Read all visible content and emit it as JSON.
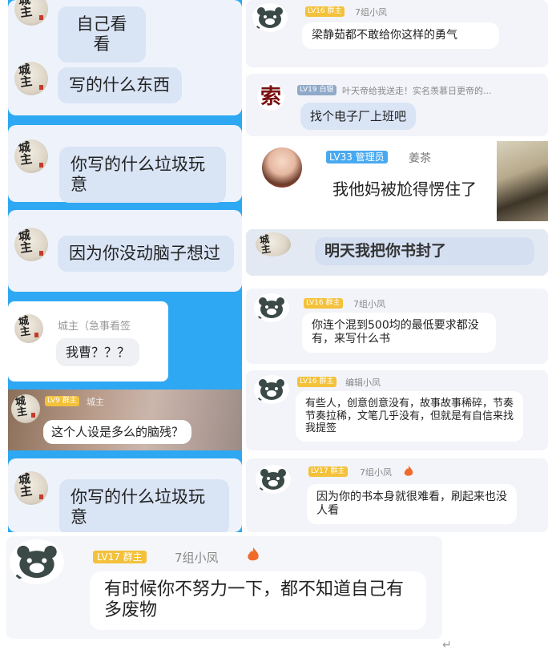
{
  "left_panel": {
    "messages": [
      {
        "text": "自己看看"
      },
      {
        "text": "写的什么东西"
      },
      {
        "text": "你写的什么垃圾玩意"
      },
      {
        "text": "因为你没动脑子想过"
      },
      {
        "nick": "城主（急事看签",
        "text": "我曹？？？"
      },
      {
        "badge": "LV9 群主",
        "nick": "城主",
        "text": "这个人设是多么的脑残？"
      },
      {
        "text": "你写的什么垃圾玩意"
      }
    ]
  },
  "right_panel": {
    "messages": [
      {
        "badge": "LV16 群主",
        "nick": "7组小凤",
        "text": "梁静茹都不敢给你这样的勇气"
      },
      {
        "badge": "LV19 白银",
        "nick": "叶天帝给我送走！实名羡慕日更帝的...",
        "text": "找个电子厂上班吧"
      },
      {
        "badge": "LV33 管理员",
        "nick": "姜茶",
        "text": "我他妈被尬得愣住了"
      },
      {
        "text": "明天我把你书封了"
      },
      {
        "badge": "LV16 群主",
        "nick": "7组小凤",
        "text": "你连个混到500均的最低要求都没有，来写什么书"
      },
      {
        "badge": "LV16 群主",
        "nick": "编辑小凤",
        "text": "有些人，创意创意没有，故事故事稀碎，节奏节奏拉稀，文笔几乎没有，但就是有自信来找我提签"
      },
      {
        "badge": "LV17 群主",
        "nick": "7组小凤",
        "text": "因为你的书本身就很难看，刷起来也没人看"
      }
    ],
    "seal_avatar_glyph": "索"
  },
  "bottom_panel": {
    "badge": "LV17 群主",
    "nick": "7组小凤",
    "text": "有时候你不努力一下，都不知道自己有多废物",
    "return_glyph": "↵"
  },
  "colors": {
    "left_bg": "#2ea8f2",
    "badge_yellow": "#f3c13a",
    "badge_blue": "#49a9ef",
    "badge_gray": "#8fa9c8",
    "flame": "#f06a2a"
  }
}
